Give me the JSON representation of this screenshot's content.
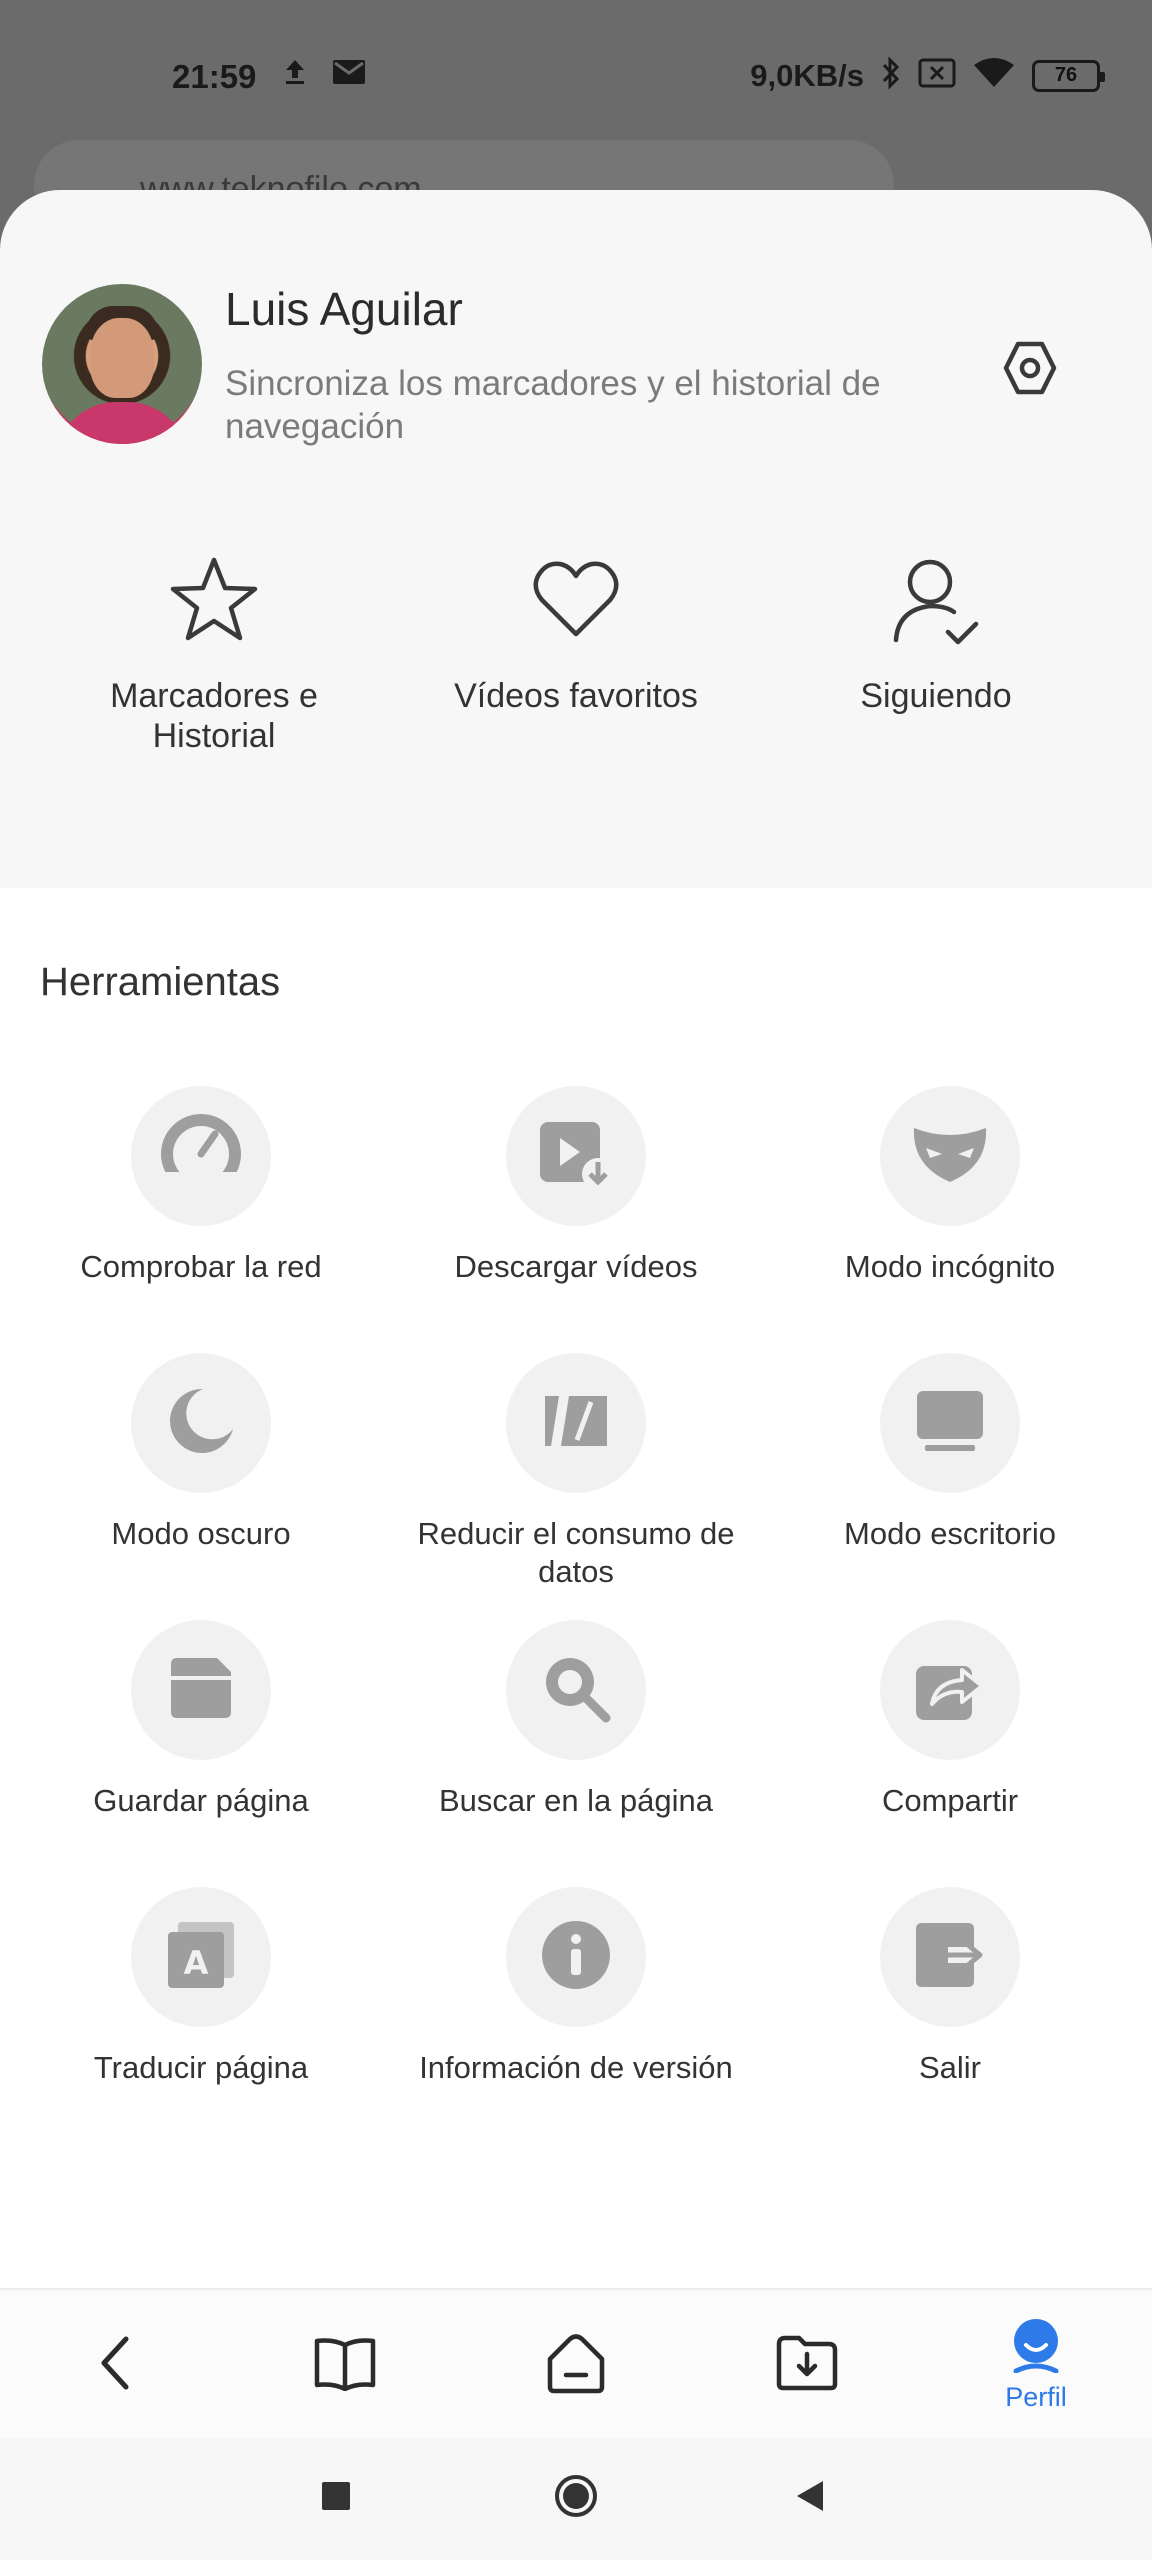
{
  "status_bar": {
    "time": "21:59",
    "speed": "9,0KB/s",
    "battery": "76"
  },
  "browser": {
    "url_peek": "www.teknofilo.com"
  },
  "profile": {
    "name": "Luis Aguilar",
    "subtitle": "Sincroniza los marcadores y el historial de navegación"
  },
  "quick_actions": [
    {
      "label": "Marcadores e\nHistorial",
      "icon": "star-icon"
    },
    {
      "label": "Vídeos favoritos",
      "icon": "heart-icon"
    },
    {
      "label": "Siguiendo",
      "icon": "user-check-icon"
    }
  ],
  "tools": {
    "title": "Herramientas",
    "items": [
      {
        "label": "Comprobar la red",
        "icon": "speedometer-icon"
      },
      {
        "label": "Descargar vídeos",
        "icon": "video-download-icon"
      },
      {
        "label": "Modo incógnito",
        "icon": "mask-icon"
      },
      {
        "label": "Modo oscuro",
        "icon": "moon-icon"
      },
      {
        "label": "Reducir el consumo de datos",
        "icon": "data-saver-icon"
      },
      {
        "label": "Modo escritorio",
        "icon": "desktop-icon"
      },
      {
        "label": "Guardar página",
        "icon": "save-icon"
      },
      {
        "label": "Buscar en la página",
        "icon": "search-icon"
      },
      {
        "label": "Compartir",
        "icon": "share-icon"
      },
      {
        "label": "Traducir página",
        "icon": "translate-icon"
      },
      {
        "label": "Información de versión",
        "icon": "info-icon"
      },
      {
        "label": "Salir",
        "icon": "exit-icon"
      }
    ]
  },
  "bottom_nav": {
    "profile_label": "Perfil",
    "accent": "#2d7ae8"
  }
}
